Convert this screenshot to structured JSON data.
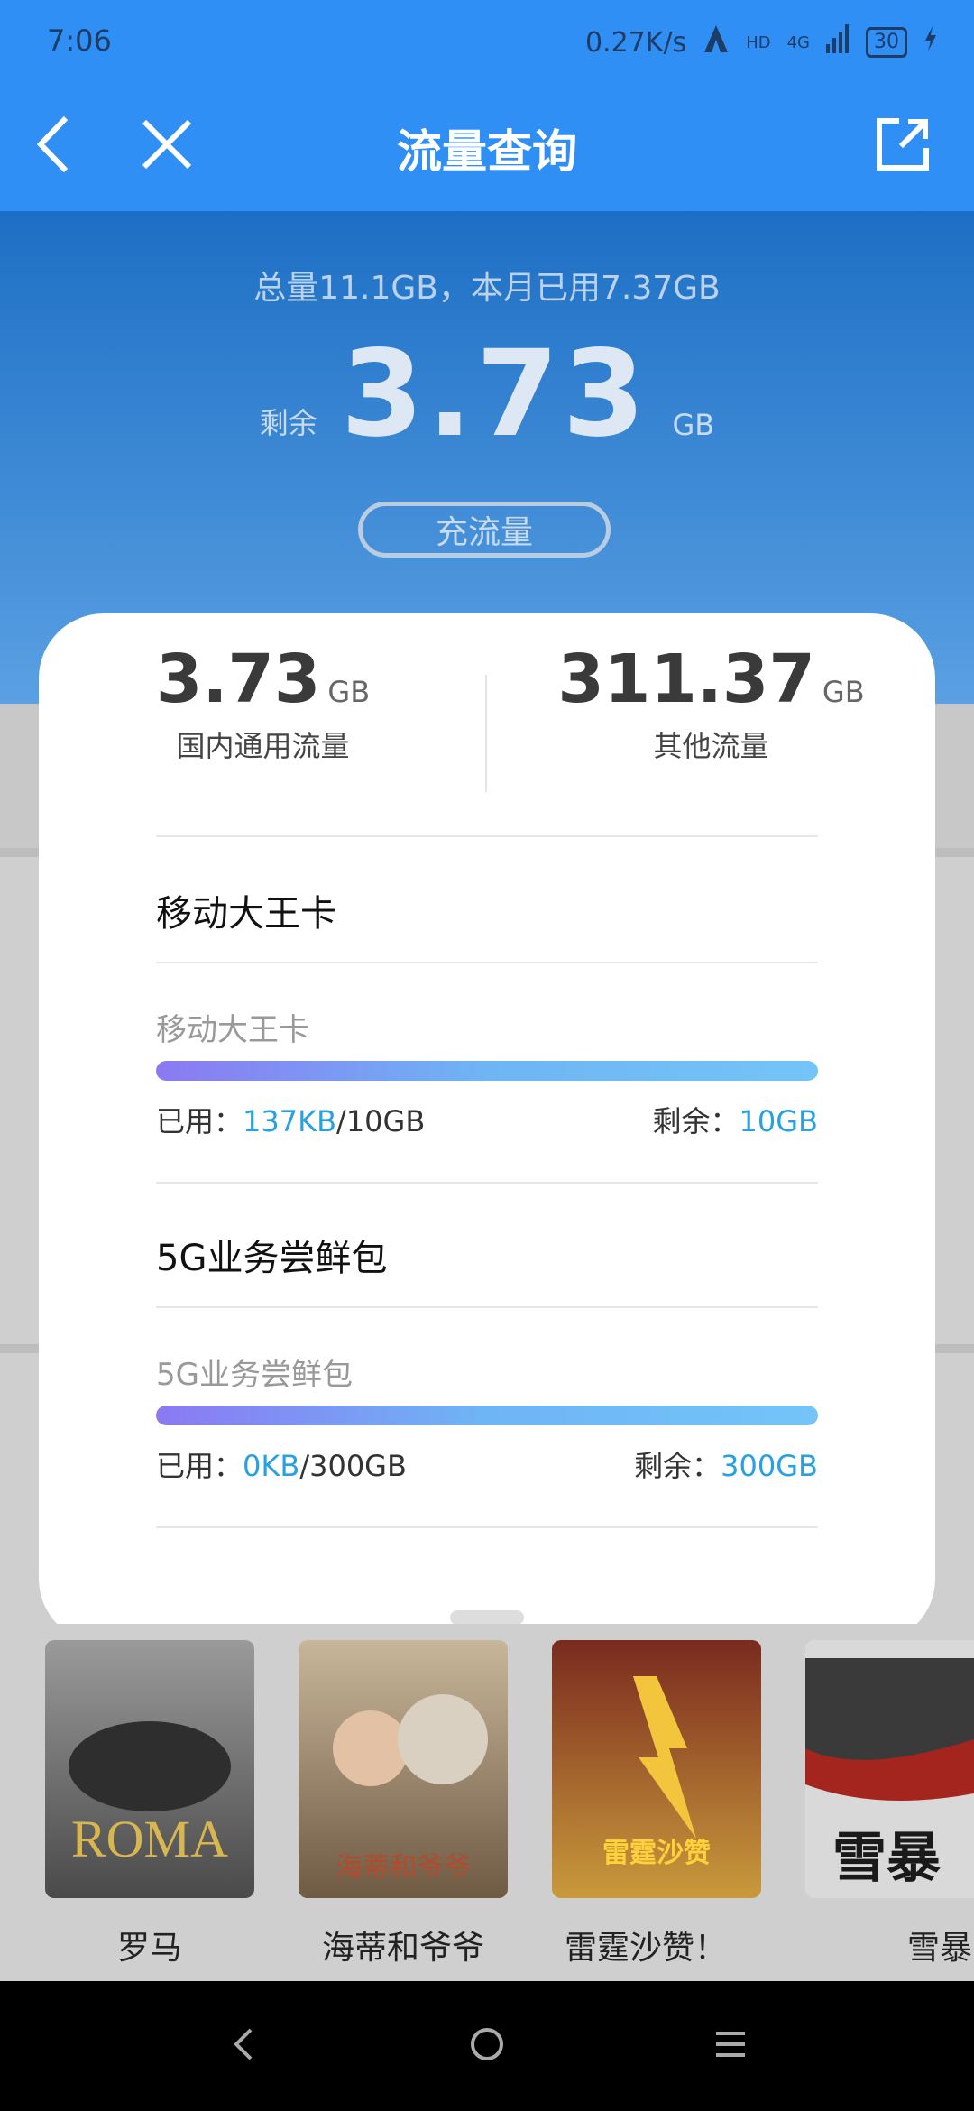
{
  "status_bar": {
    "time": "7:06",
    "network_speed": "0.27K/s",
    "signal_text": "HD",
    "network_type": "4G",
    "battery": "30"
  },
  "toolbar": {
    "title": "流量查询",
    "back_icon": "chevron-left-icon",
    "close_icon": "close-icon",
    "share_icon": "external-link-icon"
  },
  "summary": {
    "total_text": "总量11.1GB，本月已用7.37GB",
    "remain_label": "剩余",
    "remain_value": "3.73",
    "remain_unit": "GB",
    "recharge_label": "充流量"
  },
  "card": {
    "stats": [
      {
        "value": "3.73",
        "unit": "GB",
        "label": "国内通用流量"
      },
      {
        "value": "311.37",
        "unit": "GB",
        "label": "其他流量"
      }
    ],
    "packages": [
      {
        "title": "移动大王卡",
        "subtitle": "移动大王卡",
        "used_label": "已用：",
        "used_value": "137KB",
        "total": "/10GB",
        "remain_label": "剩余：",
        "remain_value": "10GB",
        "used_fraction": 1e-05
      },
      {
        "title": "5G业务尝鲜包",
        "subtitle": "5G业务尝鲜包",
        "used_label": "已用：",
        "used_value": "0KB",
        "total": "/300GB",
        "remain_label": "剩余：",
        "remain_value": "300GB",
        "used_fraction": 0
      }
    ]
  },
  "movies": [
    {
      "title": "罗马",
      "poster_text": "ROMA",
      "colors": [
        "#4a4a4a",
        "#9a9a9a"
      ]
    },
    {
      "title": "海蒂和爷爷",
      "poster_text": "海蒂和爷爷",
      "colors": [
        "#6f5a44",
        "#c8b69a"
      ]
    },
    {
      "title": "雷霆沙赞！",
      "poster_text": "雷霆沙赞",
      "colors": [
        "#7a2a1e",
        "#c99a3c"
      ]
    },
    {
      "title": "雪暴",
      "poster_text": "雪暴",
      "colors": [
        "#3a3a3a",
        "#d9d9d9"
      ]
    }
  ],
  "nav_bar": {
    "back_icon": "nav-back-icon",
    "home_icon": "nav-home-icon",
    "menu_icon": "nav-menu-icon"
  },
  "colors": {
    "toolbar_blue": "#2f8ff5",
    "highlight": "#2aa0e0"
  }
}
